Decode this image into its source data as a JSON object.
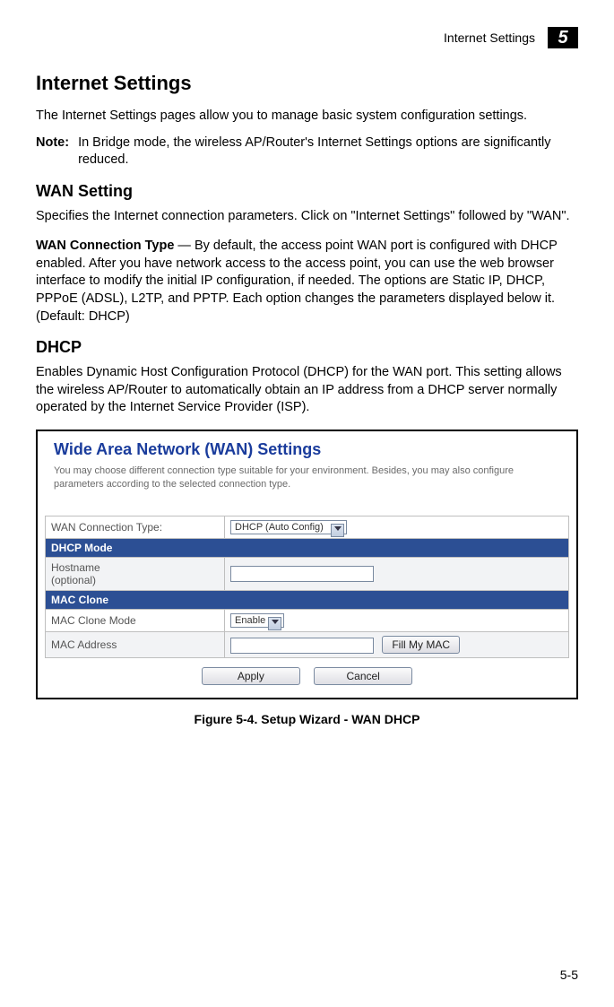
{
  "header": {
    "section": "Internet Settings",
    "chapter": "5"
  },
  "h1": "Internet Settings",
  "intro": "The Internet Settings pages allow you to manage basic system configuration settings.",
  "note": {
    "label": "Note:",
    "text": "In Bridge mode, the wireless AP/Router's Internet Settings options are significantly reduced."
  },
  "h2a": "WAN Setting",
  "wan_setting_desc": "Specifies the Internet connection parameters. Click on \"Internet Settings\" followed by \"WAN\".",
  "wan_conn_type": {
    "label": "WAN Connection Type",
    "sep": " — ",
    "text": "By default, the access point WAN port is configured with DHCP enabled. After you have network access to the access point, you can use the web browser interface to modify the initial IP configuration, if needed. The options are Static IP, DHCP, PPPoE (ADSL), L2TP, and PPTP. Each option changes the parameters displayed below it. (Default: DHCP)"
  },
  "h2b": "DHCP",
  "dhcp_desc": "Enables Dynamic Host Configuration Protocol (DHCP) for the WAN port. This setting allows the wireless AP/Router to automatically obtain an IP address from a DHCP server normally operated by the Internet Service Provider (ISP).",
  "screenshot": {
    "title": "Wide Area Network (WAN) Settings",
    "desc": "You may choose different connection type suitable for your environment. Besides, you may also configure parameters according to the selected connection type.",
    "rows": {
      "wan_connection_type_label": "WAN Connection Type:",
      "wan_connection_type_value": "DHCP (Auto Config)",
      "dhcp_mode_header": "DHCP Mode",
      "hostname_label": "Hostname\n(optional)",
      "hostname_value": "",
      "mac_clone_header": "MAC Clone",
      "mac_clone_mode_label": "MAC Clone Mode",
      "mac_clone_mode_value": "Enable",
      "mac_address_label": "MAC Address",
      "mac_address_value": "",
      "fill_my_mac": "Fill My MAC",
      "apply": "Apply",
      "cancel": "Cancel"
    }
  },
  "figure_caption": "Figure 5-4.   Setup Wizard - WAN DHCP",
  "page_number": "5-5"
}
